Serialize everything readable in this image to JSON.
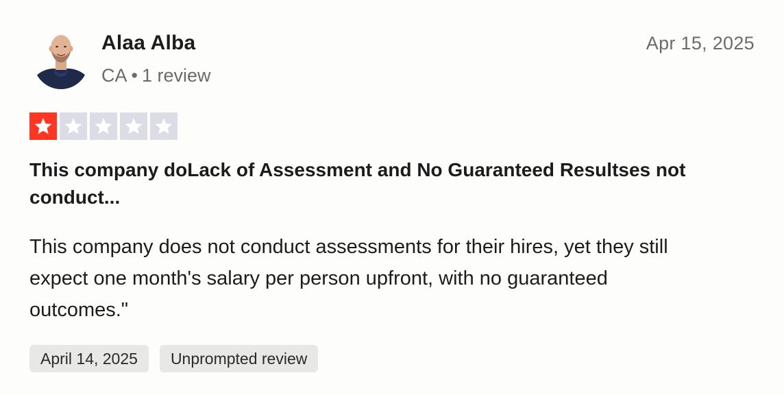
{
  "reviewer": {
    "name": "Alaa Alba",
    "country": "CA",
    "separator": "•",
    "review_count": "1 review"
  },
  "review": {
    "date": "Apr 15, 2025",
    "rating": 1,
    "rating_max": 5,
    "title": "This company doLack of Assessment and No Guaranteed Resultses not conduct...",
    "body": "This company does not conduct assessments for their hires, yet they still expect one month's salary per person upfront, with no guaranteed outcomes.\""
  },
  "tags": {
    "experience_date": "April 14, 2025",
    "review_type": "Unprompted review"
  },
  "colors": {
    "star_filled": "#ff3722",
    "star_empty": "#dcdce6"
  },
  "icons": {
    "avatar": "person-avatar-icon",
    "star": "star-icon"
  }
}
